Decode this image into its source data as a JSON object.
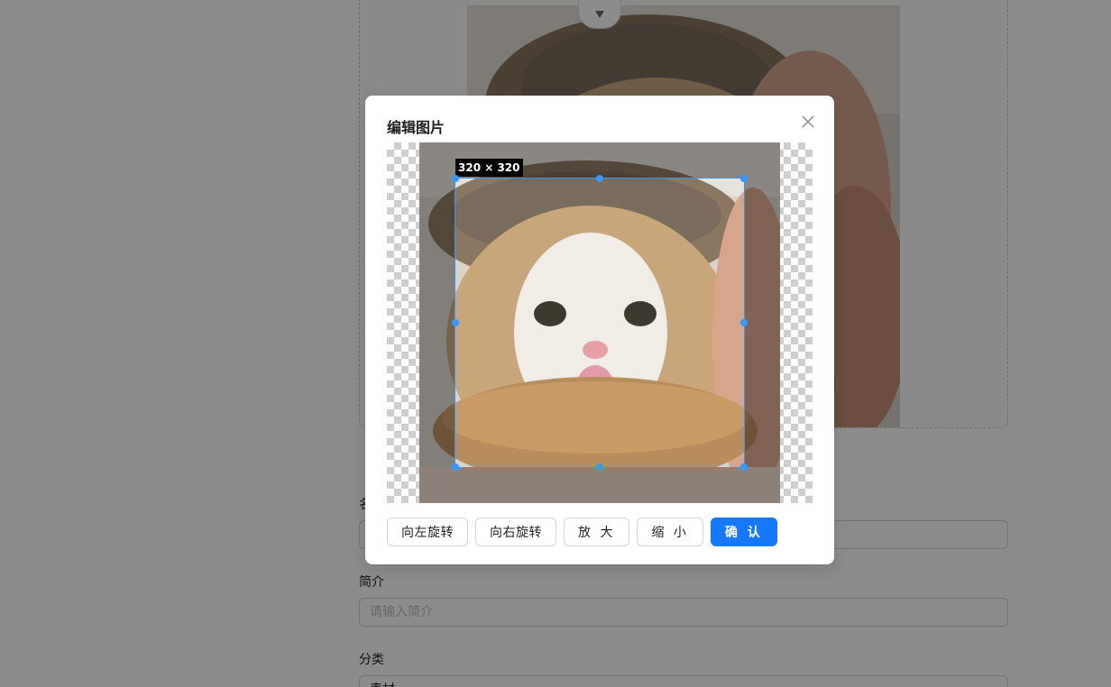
{
  "colors": {
    "primary": "#1677ff",
    "crop_border": "#3399ff",
    "mask": "rgba(0,0,0,0.45)"
  },
  "form": {
    "name_label": "名称",
    "intro_label": "简介",
    "intro_placeholder": "请输入简介",
    "category_label": "分类",
    "category_value": "素材"
  },
  "modal": {
    "title": "编辑图片",
    "close_icon": "close-icon",
    "crop_size_label": "320 × 320",
    "buttons": {
      "rotate_left": "向左旋转",
      "rotate_right": "向右旋转",
      "zoom_in": "放 大",
      "zoom_out": "缩 小",
      "confirm": "确 认"
    }
  }
}
